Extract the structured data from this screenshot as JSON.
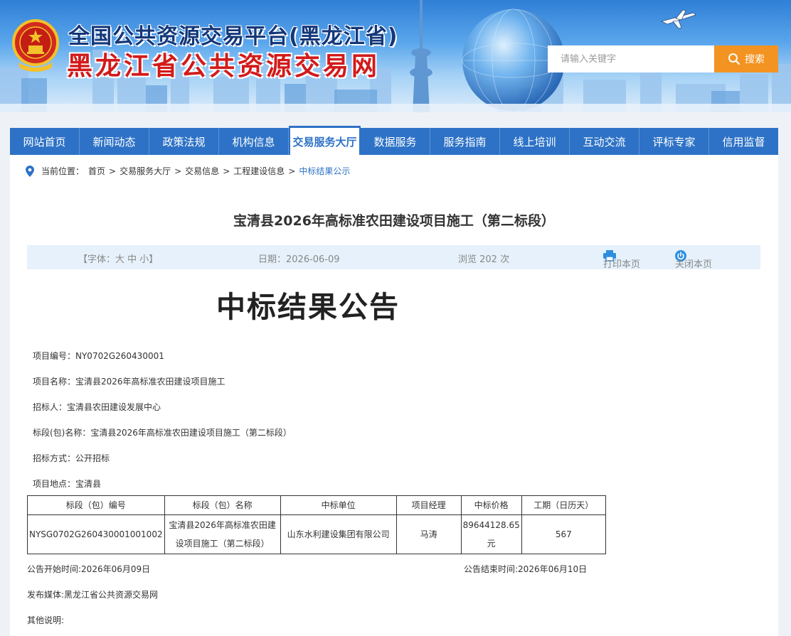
{
  "header": {
    "title_line1": "全国公共资源交易平台(黑龙江省)",
    "title_line2": "黑龙江省公共资源交易网",
    "search_placeholder": "请输入关键字",
    "search_button": "搜索"
  },
  "nav": {
    "items": [
      "网站首页",
      "新闻动态",
      "政策法规",
      "机构信息",
      "交易服务大厅",
      "数据服务",
      "服务指南",
      "线上培训",
      "互动交流",
      "评标专家",
      "信用监督"
    ],
    "active_index": 4
  },
  "breadcrumb": {
    "prefix": "当前位置：",
    "items": [
      "首页",
      "交易服务大厅",
      "交易信息",
      "工程建设信息"
    ],
    "current": "中标结果公示",
    "separator": ">"
  },
  "article": {
    "title": "宝清县2026年高标准农田建设项目施工（第二标段）",
    "font_control": "【字体：大 中 小】",
    "date": "日期：2026-06-09",
    "views": "浏览 202 次",
    "print": "打印本页",
    "close": "关闭本页",
    "heading": "中标结果公告"
  },
  "fields": [
    "项目编号：NY0702G260430001",
    "项目名称：宝清县2026年高标准农田建设项目施工",
    "招标人：宝清县农田建设发展中心",
    "标段(包)名称：宝清县2026年高标准农田建设项目施工（第二标段）",
    "招标方式：公开招标",
    "项目地点：宝清县"
  ],
  "table": {
    "headers": [
      "标段（包）编号",
      "标段（包）名称",
      "中标单位",
      "项目经理",
      "中标价格",
      "工期（日历天）"
    ],
    "row": {
      "code": "NYSG0702G260430001001002",
      "name_line1": "宝清县2026年高标准农田建",
      "name_line2": "设项目施工（第二标段）",
      "winner": "山东水利建设集团有限公司",
      "manager": "马涛",
      "price_line1": "89644128.65",
      "price_line2": "元",
      "duration": "567"
    }
  },
  "footer": {
    "start": "公告开始时间:2026年06月09日",
    "end": "公告结束时间:2026年06月10日",
    "media": "发布媒体:黑龙江省公共资源交易网",
    "other": "其他说明:"
  },
  "colors": {
    "nav_blue": "#2d72c6",
    "search_orange": "#f39322",
    "title_red": "#d21a1a",
    "title_navy": "#13377a",
    "info_bar": "#e6f1fb"
  }
}
